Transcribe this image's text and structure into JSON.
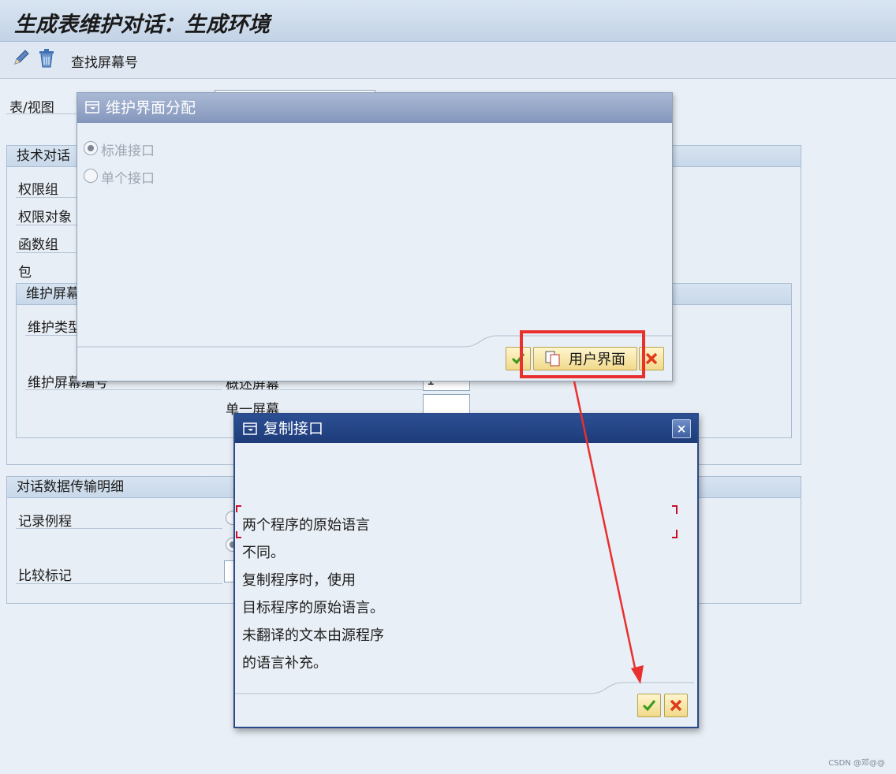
{
  "window": {
    "title": "生成表维护对话：生成环境"
  },
  "toolbar": {
    "edit_icon": "pencil-icon",
    "delete_icon": "trash-icon",
    "find_screen_label": "查找屏幕号"
  },
  "main": {
    "table_view_label": "表/视图",
    "tech_group": {
      "header": "技术对话",
      "auth_group": "权限组",
      "auth_object": "权限对象",
      "function_group": "函数组",
      "package": "包"
    },
    "maint_screen_group": {
      "header": "维护屏幕",
      "maint_type": "维护类型",
      "maint_screen_no": "维护屏幕编号",
      "overview_screen": "概述屏幕",
      "overview_value": "1",
      "single_screen": "单一屏幕"
    },
    "transport_group": {
      "header": "对话数据传输明细",
      "record_routine": "记录例程",
      "compare_flag": "比较标记"
    }
  },
  "dialog_maint_interface": {
    "title": "维护界面分配",
    "options": [
      "标准接口",
      "单个接口"
    ],
    "selected": 0,
    "user_interface_button": "用户界面"
  },
  "dialog_copy_interface": {
    "title": "复制接口",
    "close": "×",
    "message": [
      "两个程序的原始语言",
      "不同。",
      "复制程序时，使用",
      "目标程序的原始语言。",
      "未翻译的文本由源程序",
      "的语言补充。"
    ]
  },
  "colors": {
    "highlight_red": "#e8302f",
    "dialog_header_active": "#1d3b78",
    "dialog_header_inactive": "#8496bc"
  },
  "watermark": "CSDN @邓@@"
}
